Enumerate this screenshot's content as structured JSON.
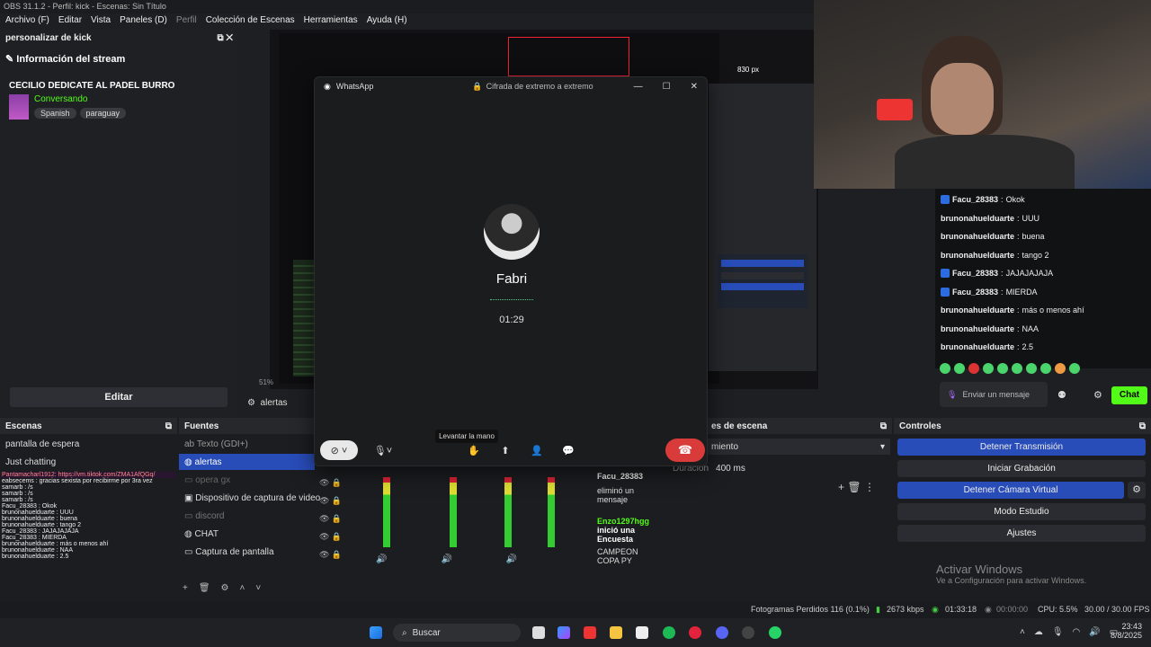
{
  "titlebar": "OBS 31.1.2 - Perfil: kick - Escenas: Sin Título",
  "menu": [
    "Archivo (F)",
    "Editar",
    "Vista",
    "Paneles (D)",
    "Perfil",
    "Colección de Escenas",
    "Herramientas",
    "Ayuda (H)"
  ],
  "dock": {
    "title": "personalizar de kick",
    "section": "Información del stream",
    "stream_title": "CECILIO DEDICATE AL PADEL BURRO",
    "category": "Conversando",
    "tags": [
      "Spanish",
      "paraguay"
    ],
    "edit_label": "Editar"
  },
  "preview": {
    "zoom": "51%",
    "resolution_overlay": "830 px"
  },
  "whatsapp": {
    "app": "WhatsApp",
    "encryption": "Cifrada de extremo a extremo",
    "contact": "Fabri",
    "duration": "01:29",
    "tooltip": "Levantar la mano"
  },
  "chat": {
    "messages": [
      {
        "user": "Facu_28383",
        "text": "Okok",
        "badge": true
      },
      {
        "user": "brunonahuelduarte",
        "text": "UUU",
        "badge": false
      },
      {
        "user": "brunonahuelduarte",
        "text": "buena",
        "badge": false
      },
      {
        "user": "brunonahuelduarte",
        "text": "tango 2",
        "badge": false
      },
      {
        "user": "Facu_28383",
        "text": "JAJAJAJAJA",
        "badge": true
      },
      {
        "user": "Facu_28383",
        "text": "MIERDA",
        "badge": true
      },
      {
        "user": "brunonahuelduarte",
        "text": "más o menos ahí",
        "badge": false
      },
      {
        "user": "brunonahuelduarte",
        "text": "NAA",
        "badge": false
      },
      {
        "user": "brunonahuelduarte",
        "text": "2.5",
        "badge": false
      }
    ],
    "input_placeholder": "Enviar un mensaje",
    "send_label": "Chat"
  },
  "scenes": {
    "title": "Escenas",
    "items": [
      "pantalla de espera",
      "Just chatting"
    ]
  },
  "sources": {
    "title": "Fuentes",
    "items": [
      "Texto (GDI+)",
      "alertas",
      "opera gx",
      "Dispositivo de captura de video",
      "discord",
      "CHAT",
      "Captura de pantalla"
    ],
    "preview_source": "alertas"
  },
  "transitions": {
    "title": "es de escena",
    "type": "miento",
    "duration_label": "Duración",
    "duration": "400 ms"
  },
  "mini_chat": [
    {
      "user": "Facu_28383",
      "text": "eliminó un mensaje"
    },
    {
      "user": "Enzo1297hgg",
      "text": "inició una Encuesta"
    },
    {
      "user": "",
      "text": "CAMPEON COPA PY"
    }
  ],
  "left_chat": [
    "Pantamacharl1912: https://vm.tiktok.com/ZMA1AfQGq/",
    "eabsecems : gracias sexista por recibirme por 3ra vez",
    "samarb : /s",
    "samarb : /s",
    "samarb : /s",
    "Facu_28383 : Okok",
    "brunonahuelduarte : UUU",
    "brunonahuelduarte : buena",
    "brunonahuelduarte : tango 2",
    "Facu_28383 : JAJAJAJAJA",
    "Facu_28383 : MIERDA",
    "brunonahuelduarte : más o menos ahí",
    "brunonahuelduarte : NAA",
    "brunonahuelduarte : 2.5"
  ],
  "controls": {
    "title": "Controles",
    "buttons": [
      {
        "label": "Detener Transmisión",
        "active": true
      },
      {
        "label": "Iniciar Grabación",
        "active": false
      },
      {
        "label": "Detener Cámara Virtual",
        "active": true
      },
      {
        "label": "Modo Estudio",
        "active": false
      },
      {
        "label": "Ajustes",
        "active": false
      }
    ]
  },
  "activate": {
    "title": "Activar Windows",
    "subtitle": "Ve a Configuración para activar Windows."
  },
  "status": {
    "dropped": "Fotogramas Perdidos 116 (0.1%)",
    "bitrate": "2673 kbps",
    "live_time": "01:33:18",
    "rec_time": "00:00:00",
    "cpu": "CPU: 5.5%",
    "fps": "30.00 / 30.00 FPS"
  },
  "taskbar": {
    "search": "Buscar",
    "time": "23:43",
    "date": "8/8/2025"
  },
  "colors": {
    "accent": "#284cb8",
    "kick_green": "#53fc18",
    "end_call": "#d93b3b"
  }
}
